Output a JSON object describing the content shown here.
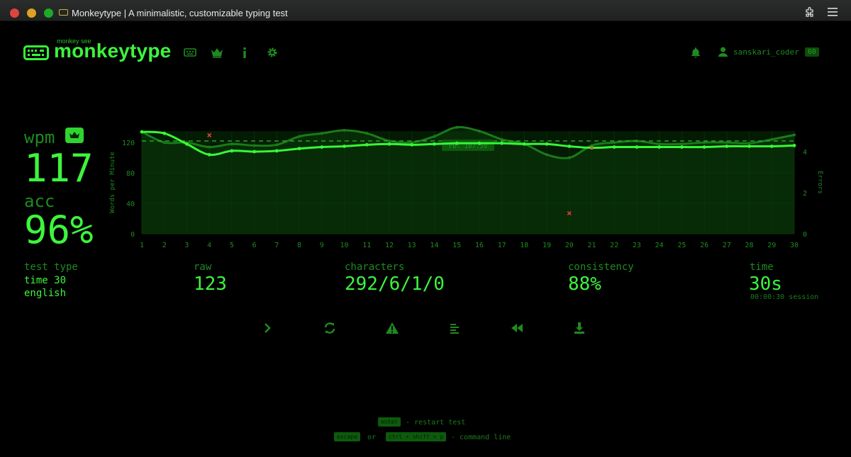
{
  "window": {
    "title": "Monkeytype | A minimalistic, customizable typing test"
  },
  "header": {
    "logo_sub": "monkey see",
    "logo_text": "monkeytype",
    "username": "sanskari_coder",
    "level": "60"
  },
  "result": {
    "wpm_label": "wpm",
    "wpm": "117",
    "acc_label": "acc",
    "acc": "96%",
    "test_type_label": "test type",
    "test_type_line1": "time 30",
    "test_type_line2": "english",
    "raw_label": "raw",
    "raw": "123",
    "characters_label": "characters",
    "characters": "292/6/1/0",
    "consistency_label": "consistency",
    "consistency": "88%",
    "time_label": "time",
    "time": "30s",
    "session": "00:00:30 session"
  },
  "chart_data": {
    "type": "line",
    "ylabel": "Words per Minute",
    "y2label": "Errors",
    "pb_label": "PB: 107.59",
    "pb_value": 122,
    "x": [
      1,
      2,
      3,
      4,
      5,
      6,
      7,
      8,
      9,
      10,
      11,
      12,
      13,
      14,
      15,
      16,
      17,
      18,
      19,
      20,
      21,
      22,
      23,
      24,
      25,
      26,
      27,
      28,
      29,
      30
    ],
    "ylim": [
      0,
      135
    ],
    "yticks": [
      0,
      40,
      80,
      120
    ],
    "y2lim": [
      0,
      5
    ],
    "y2ticks": [
      0,
      2,
      4
    ],
    "series": [
      {
        "values": [
          134,
          132,
          118,
          104,
          109,
          108,
          109,
          112,
          114,
          115,
          117,
          118,
          117,
          118,
          119,
          119,
          119,
          118,
          118,
          115,
          113,
          114,
          114,
          114,
          114,
          114,
          115,
          115,
          115,
          116
        ]
      },
      {
        "values": [
          134,
          120,
          120,
          114,
          118,
          116,
          117,
          128,
          132,
          136,
          132,
          122,
          120,
          128,
          140,
          135,
          124,
          118,
          104,
          100,
          116,
          120,
          122,
          118,
          118,
          120,
          120,
          119,
          124,
          130
        ]
      }
    ],
    "errors": [
      {
        "x": 4,
        "value": 4.8
      },
      {
        "x": 20,
        "value": 1
      }
    ],
    "grid": true
  },
  "footer": {
    "enter_key": "enter",
    "restart_hint": "- restart test",
    "escape_key": "escape",
    "or": "or",
    "ctrl_key": "ctrl + shift + p",
    "command_hint": "- command line"
  }
}
